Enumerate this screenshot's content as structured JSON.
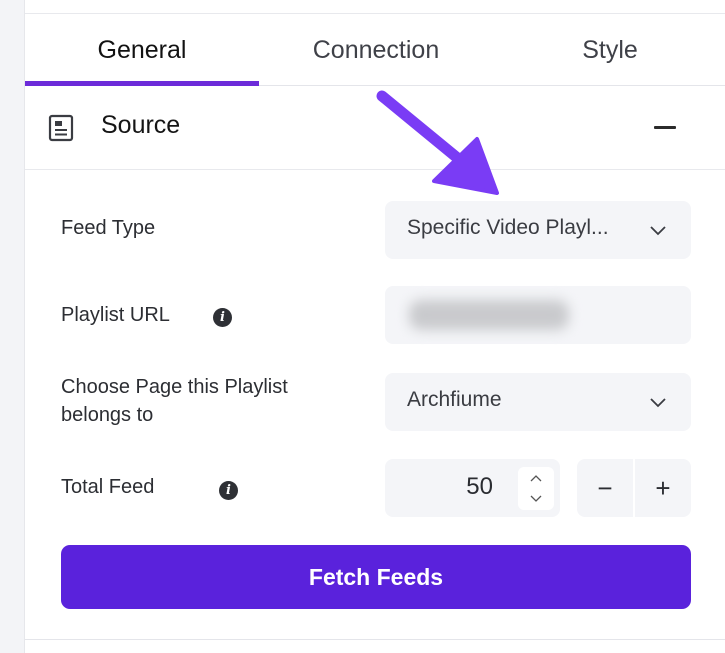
{
  "tabs": [
    {
      "label": "General",
      "active": true
    },
    {
      "label": "Connection",
      "active": false
    },
    {
      "label": "Style",
      "active": false
    }
  ],
  "section": {
    "title": "Source",
    "icon": "document-icon",
    "collapse_icon": "minus-icon"
  },
  "fields": {
    "feed_type": {
      "label": "Feed Type",
      "value": "Specific Video Playl..."
    },
    "playlist_url": {
      "label": "Playlist URL",
      "info_icon": "info-icon"
    },
    "page": {
      "label_line1": "Choose Page this Playlist",
      "label_line2": "belongs to",
      "value": "Archfiume"
    },
    "total_feed": {
      "label": "Total Feed",
      "value": "50",
      "minus": "−",
      "plus": "+"
    }
  },
  "actions": {
    "fetch_label": "Fetch Feeds"
  },
  "colors": {
    "accent": "#6c2bd9",
    "button": "#5a22dc",
    "arrow": "#7a3cf5"
  }
}
